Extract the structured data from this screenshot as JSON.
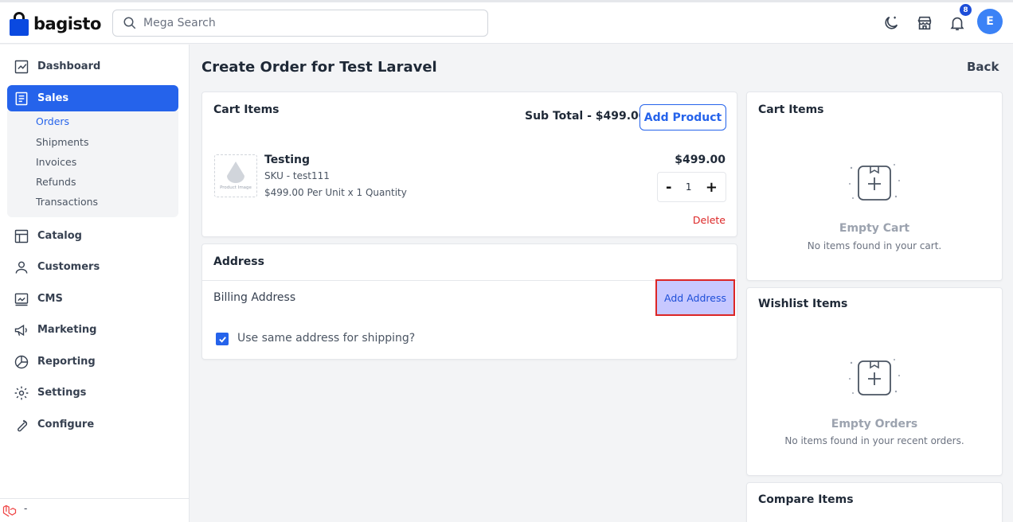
{
  "header": {
    "logo_text": "bagisto",
    "search_placeholder": "Mega Search",
    "notification_count": "8",
    "avatar_initial": "E"
  },
  "sidebar": {
    "items": [
      {
        "label": "Dashboard",
        "icon": "dashboard-icon"
      },
      {
        "label": "Sales",
        "icon": "sales-icon",
        "active": true
      },
      {
        "label": "Catalog",
        "icon": "catalog-icon"
      },
      {
        "label": "Customers",
        "icon": "customers-icon"
      },
      {
        "label": "CMS",
        "icon": "cms-icon"
      },
      {
        "label": "Marketing",
        "icon": "marketing-icon"
      },
      {
        "label": "Reporting",
        "icon": "reporting-icon"
      },
      {
        "label": "Settings",
        "icon": "settings-icon"
      },
      {
        "label": "Configure",
        "icon": "configure-icon"
      }
    ],
    "sales_sub": [
      "Orders",
      "Shipments",
      "Invoices",
      "Refunds",
      "Transactions"
    ],
    "footer_mark": "-"
  },
  "page": {
    "title": "Create Order for Test Laravel",
    "back_label": "Back"
  },
  "cart": {
    "title": "Cart Items",
    "subtotal": "Sub Total - $499.00",
    "add_product_label": "Add Product",
    "item": {
      "image_label": "Product Image",
      "name": "Testing",
      "sku": "SKU - test111",
      "unit_text": "$499.00 Per Unit x 1 Quantity",
      "price": "$499.00",
      "qty_minus": "-",
      "qty": "1",
      "qty_plus": "+",
      "delete_label": "Delete"
    }
  },
  "address": {
    "title": "Address",
    "billing_label": "Billing Address",
    "add_address_label": "Add Address",
    "same_shipping_label": "Use same address for shipping?",
    "same_shipping_checked": true
  },
  "right_panels": {
    "cart": {
      "title": "Cart Items",
      "empty_title": "Empty Cart",
      "empty_sub": "No items found in your cart."
    },
    "wishlist": {
      "title": "Wishlist Items",
      "empty_title": "Empty Orders",
      "empty_sub": "No items found in your recent orders."
    },
    "compare": {
      "title": "Compare Items"
    }
  },
  "colors": {
    "accent": "#2563eb",
    "danger": "#dc2626",
    "highlight": "#c7c8ff"
  }
}
